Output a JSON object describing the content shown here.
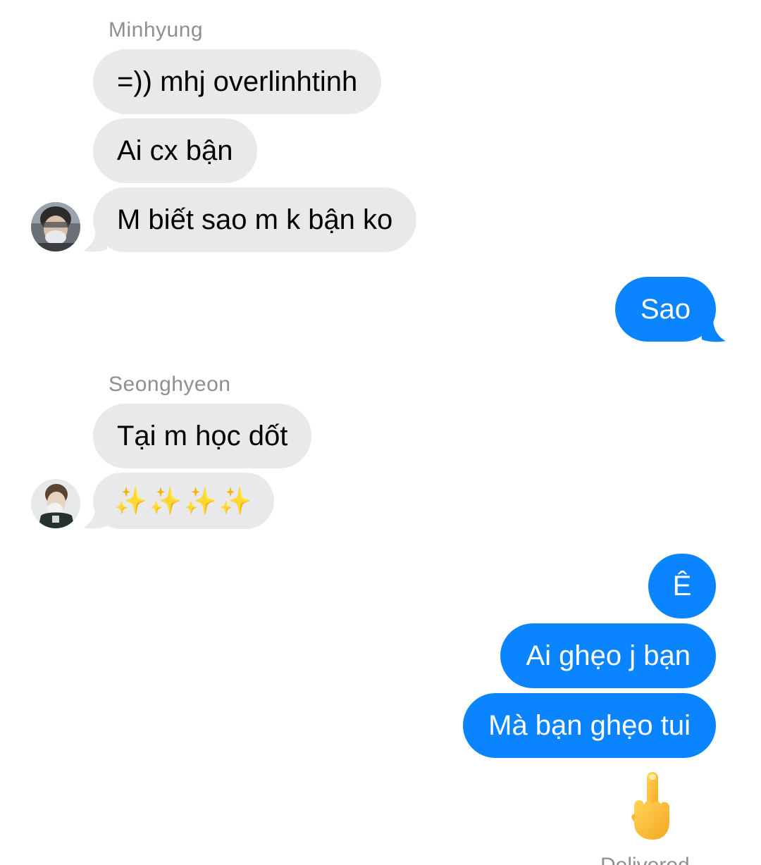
{
  "conversation": {
    "group1": {
      "sender": "Minhyung",
      "messages": [
        "=)) mhj overlinhtinh",
        "Ai cx bận",
        "M biết sao m k bận ko"
      ],
      "avatar_icon": "user-avatar-masked"
    },
    "reply1": {
      "messages": [
        "Sao"
      ]
    },
    "group2": {
      "sender": "Seonghyeon",
      "messages": [
        "Tại m học dốt",
        "✨✨✨✨"
      ],
      "avatar_icon": "user-avatar-masked"
    },
    "reply2": {
      "messages": [
        "Ê",
        "Ai ghẹo j bạn",
        "Mà bạn ghẹo tui"
      ],
      "emoji_icon": "middle-finger-emoji"
    },
    "status": "Delivered"
  },
  "colors": {
    "incoming_bubble": "#e9e9eb",
    "outgoing_bubble": "#0b84ff",
    "sender_name": "#8e8e93"
  }
}
